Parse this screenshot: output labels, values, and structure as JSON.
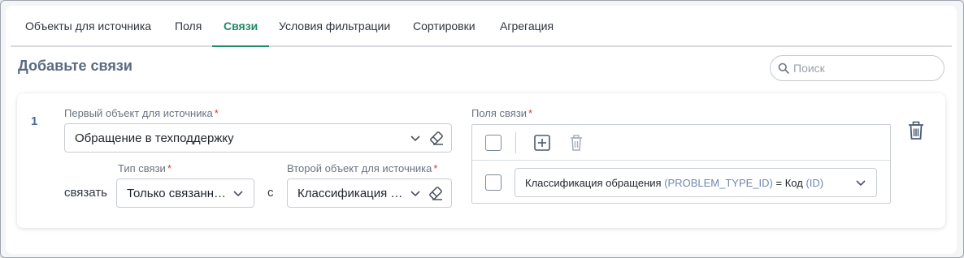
{
  "tabs": [
    {
      "label": "Объекты для источника",
      "active": false
    },
    {
      "label": "Поля",
      "active": false
    },
    {
      "label": "Связи",
      "active": true
    },
    {
      "label": "Условия фильтрации",
      "active": false
    },
    {
      "label": "Сортировки",
      "active": false
    },
    {
      "label": "Агрегация",
      "active": false
    }
  ],
  "heading": "Добавьте связи",
  "search": {
    "placeholder": "Поиск",
    "value": ""
  },
  "link": {
    "number": "1",
    "first_object": {
      "label": "Первый объект для источника",
      "value": "Обращение в техподдержку"
    },
    "connect_word": "связать",
    "link_type": {
      "label": "Тип связи",
      "value": "Только связанн…"
    },
    "with_word": "с",
    "second_object": {
      "label": "Второй объект для источника",
      "value": "Классификация …"
    },
    "fields": {
      "label": "Поля связи",
      "rows": [
        {
          "name": "Классификация обращения",
          "code": "(PROBLEM_TYPE_ID)",
          "equals": "=",
          "target_name": "Код",
          "target_code": "(ID)"
        }
      ]
    }
  },
  "required_mark": "*",
  "colors": {
    "accent": "#1f8a66",
    "required": "#d23b3b",
    "code": "#6c87b0"
  }
}
